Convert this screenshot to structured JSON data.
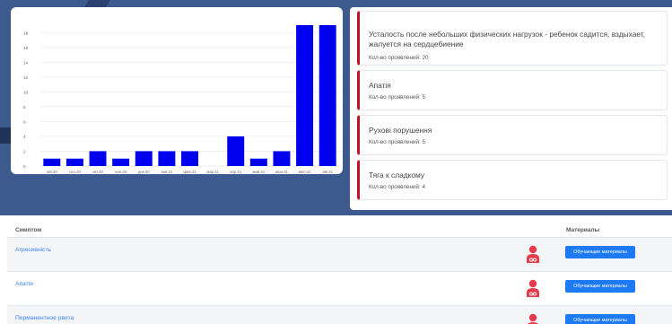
{
  "chart_data": {
    "type": "bar",
    "categories": [
      "авг.20",
      "сен.20",
      "окт.20",
      "ноя.20",
      "дек.20",
      "янв.21",
      "фев.21",
      "мар.21",
      "апр.21",
      "май.21",
      "июн.21",
      "июл.21",
      "авг.21"
    ],
    "values": [
      1,
      1,
      2,
      1,
      2,
      2,
      2,
      0,
      4,
      1,
      2,
      19,
      19
    ],
    "ylim": [
      0,
      19
    ],
    "yticks": [
      0,
      2,
      4,
      6,
      8,
      10,
      12,
      14,
      16,
      18
    ],
    "bar_color": "#0000ee",
    "grid": true,
    "title": "",
    "xlabel": "",
    "ylabel": ""
  },
  "symptoms": [
    {
      "title": "Усталость после небольших физических нагрузок - ребенок садится, вздыхает, жалуется на сердцебиение",
      "count": "Кол-во проявлений: 20"
    },
    {
      "title": "Апатія",
      "count": "Кол-во проявлений: 5"
    },
    {
      "title": "Рухові порушення",
      "count": "Кол-во проявлений: 5"
    },
    {
      "title": "Тяга к сладкому",
      "count": "Кол-во проявлений: 4"
    }
  ],
  "table": {
    "col_symptom": "Симптом",
    "col_materials": "Материалы",
    "rows": [
      {
        "symptom": "Агресивність",
        "button": "Обучающие материалы"
      },
      {
        "symptom": "Апатія",
        "button": "Обучающие материалы"
      },
      {
        "symptom": "Перманентное рвота",
        "button": "Обучающие материалы"
      }
    ]
  },
  "colors": {
    "accent": "#c8102e",
    "link": "#3b82f6",
    "button": "#1d7af2",
    "background": "#3d5a8f"
  }
}
